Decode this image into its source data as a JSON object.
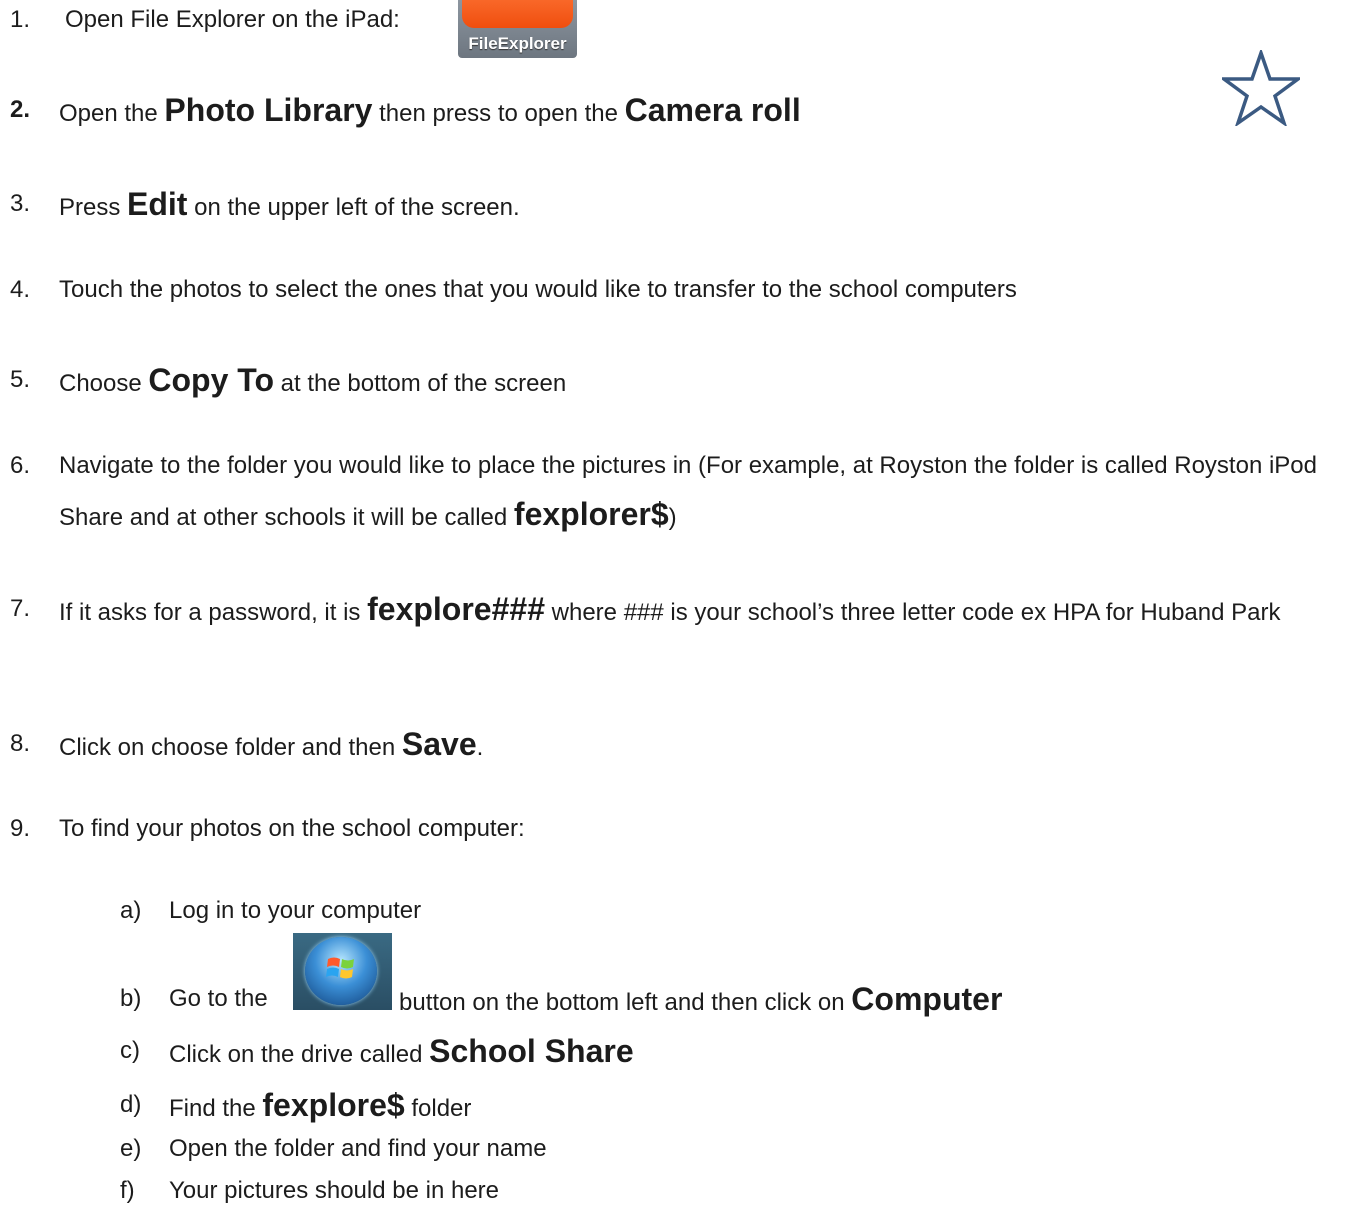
{
  "steps": {
    "s1": {
      "num": "1.",
      "text": "Open File Explorer on the iPad:"
    },
    "s2": {
      "num": "2.",
      "a": "Open the ",
      "b": "Photo Library",
      "c": " then press to open the ",
      "d": "Camera roll"
    },
    "s3": {
      "num": "3.",
      "a": "Press ",
      "b": "Edit",
      "c": " on the upper left of the screen."
    },
    "s4": {
      "num": "4.",
      "text": "Touch the photos  to select the ones that you would like to transfer to the school computers"
    },
    "s5": {
      "num": "5.",
      "a": "Choose ",
      "b": "Copy To",
      "c": " at the bottom of the screen"
    },
    "s6": {
      "num": "6.",
      "a": "Navigate to the folder you would like to place the pictures in  (For example, at Royston the folder is called Royston iPod Share and at other schools it will be called ",
      "b": "fexplorer$",
      "c": ")"
    },
    "s7": {
      "num": "7.",
      "a": "If it asks for a password, it is ",
      "b": "fexplore###",
      "c": " where ### is your school’s three letter code ex HPA for Huband Park"
    },
    "s8": {
      "num": "8.",
      "a": "Click on choose folder and then ",
      "b": "Save",
      "c": "."
    },
    "s9": {
      "num": "9.",
      "text": " To find your photos on the school computer:"
    }
  },
  "substeps": {
    "a": {
      "num": "a)",
      "text": "Log in to your computer"
    },
    "b": {
      "num": "b)",
      "a": "Go to the ",
      "c": " button on the bottom left and then click on ",
      "d": "Computer"
    },
    "c": {
      "num": "c)",
      "a": "Click on the drive called ",
      "b": "School Share"
    },
    "d": {
      "num": "d)",
      "a": "Find the ",
      "b": "fexplore$",
      "c": "  folder"
    },
    "e": {
      "num": "e)",
      "text": "Open the folder and find your name"
    },
    "f": {
      "num": "f)",
      "text": "Your pictures should be in here"
    }
  },
  "app_icon": {
    "label": "FileExplorer",
    "icon": "file-explorer-app-icon"
  },
  "windows_button": {
    "icon": "windows-start-orb-icon"
  },
  "star": {
    "icon": "star-outline-icon",
    "color": "#3b5a82"
  }
}
